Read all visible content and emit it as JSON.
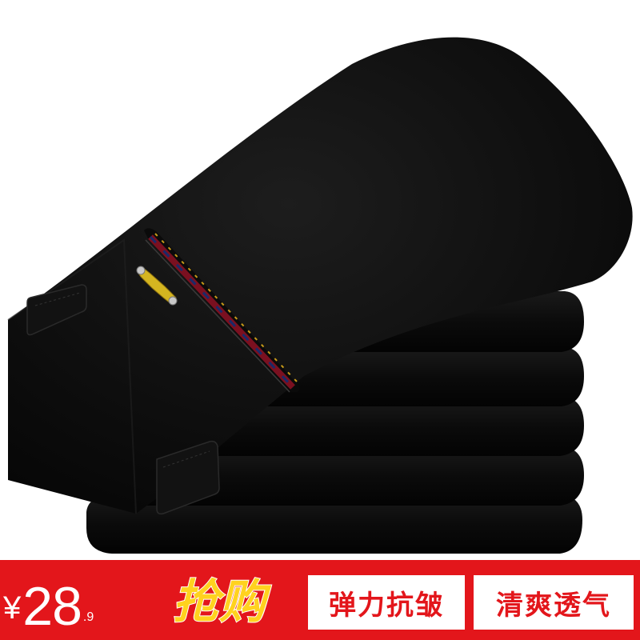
{
  "price": {
    "currency": "¥",
    "integer": "28",
    "decimal": ".9"
  },
  "promo": {
    "label": "抢购"
  },
  "tags": [
    {
      "label": "弹力抗皱"
    },
    {
      "label": "清爽透气"
    }
  ],
  "colors": {
    "banner": "#e3161b",
    "promo_text": "#ffd21f",
    "product": "#0b0b0b"
  }
}
